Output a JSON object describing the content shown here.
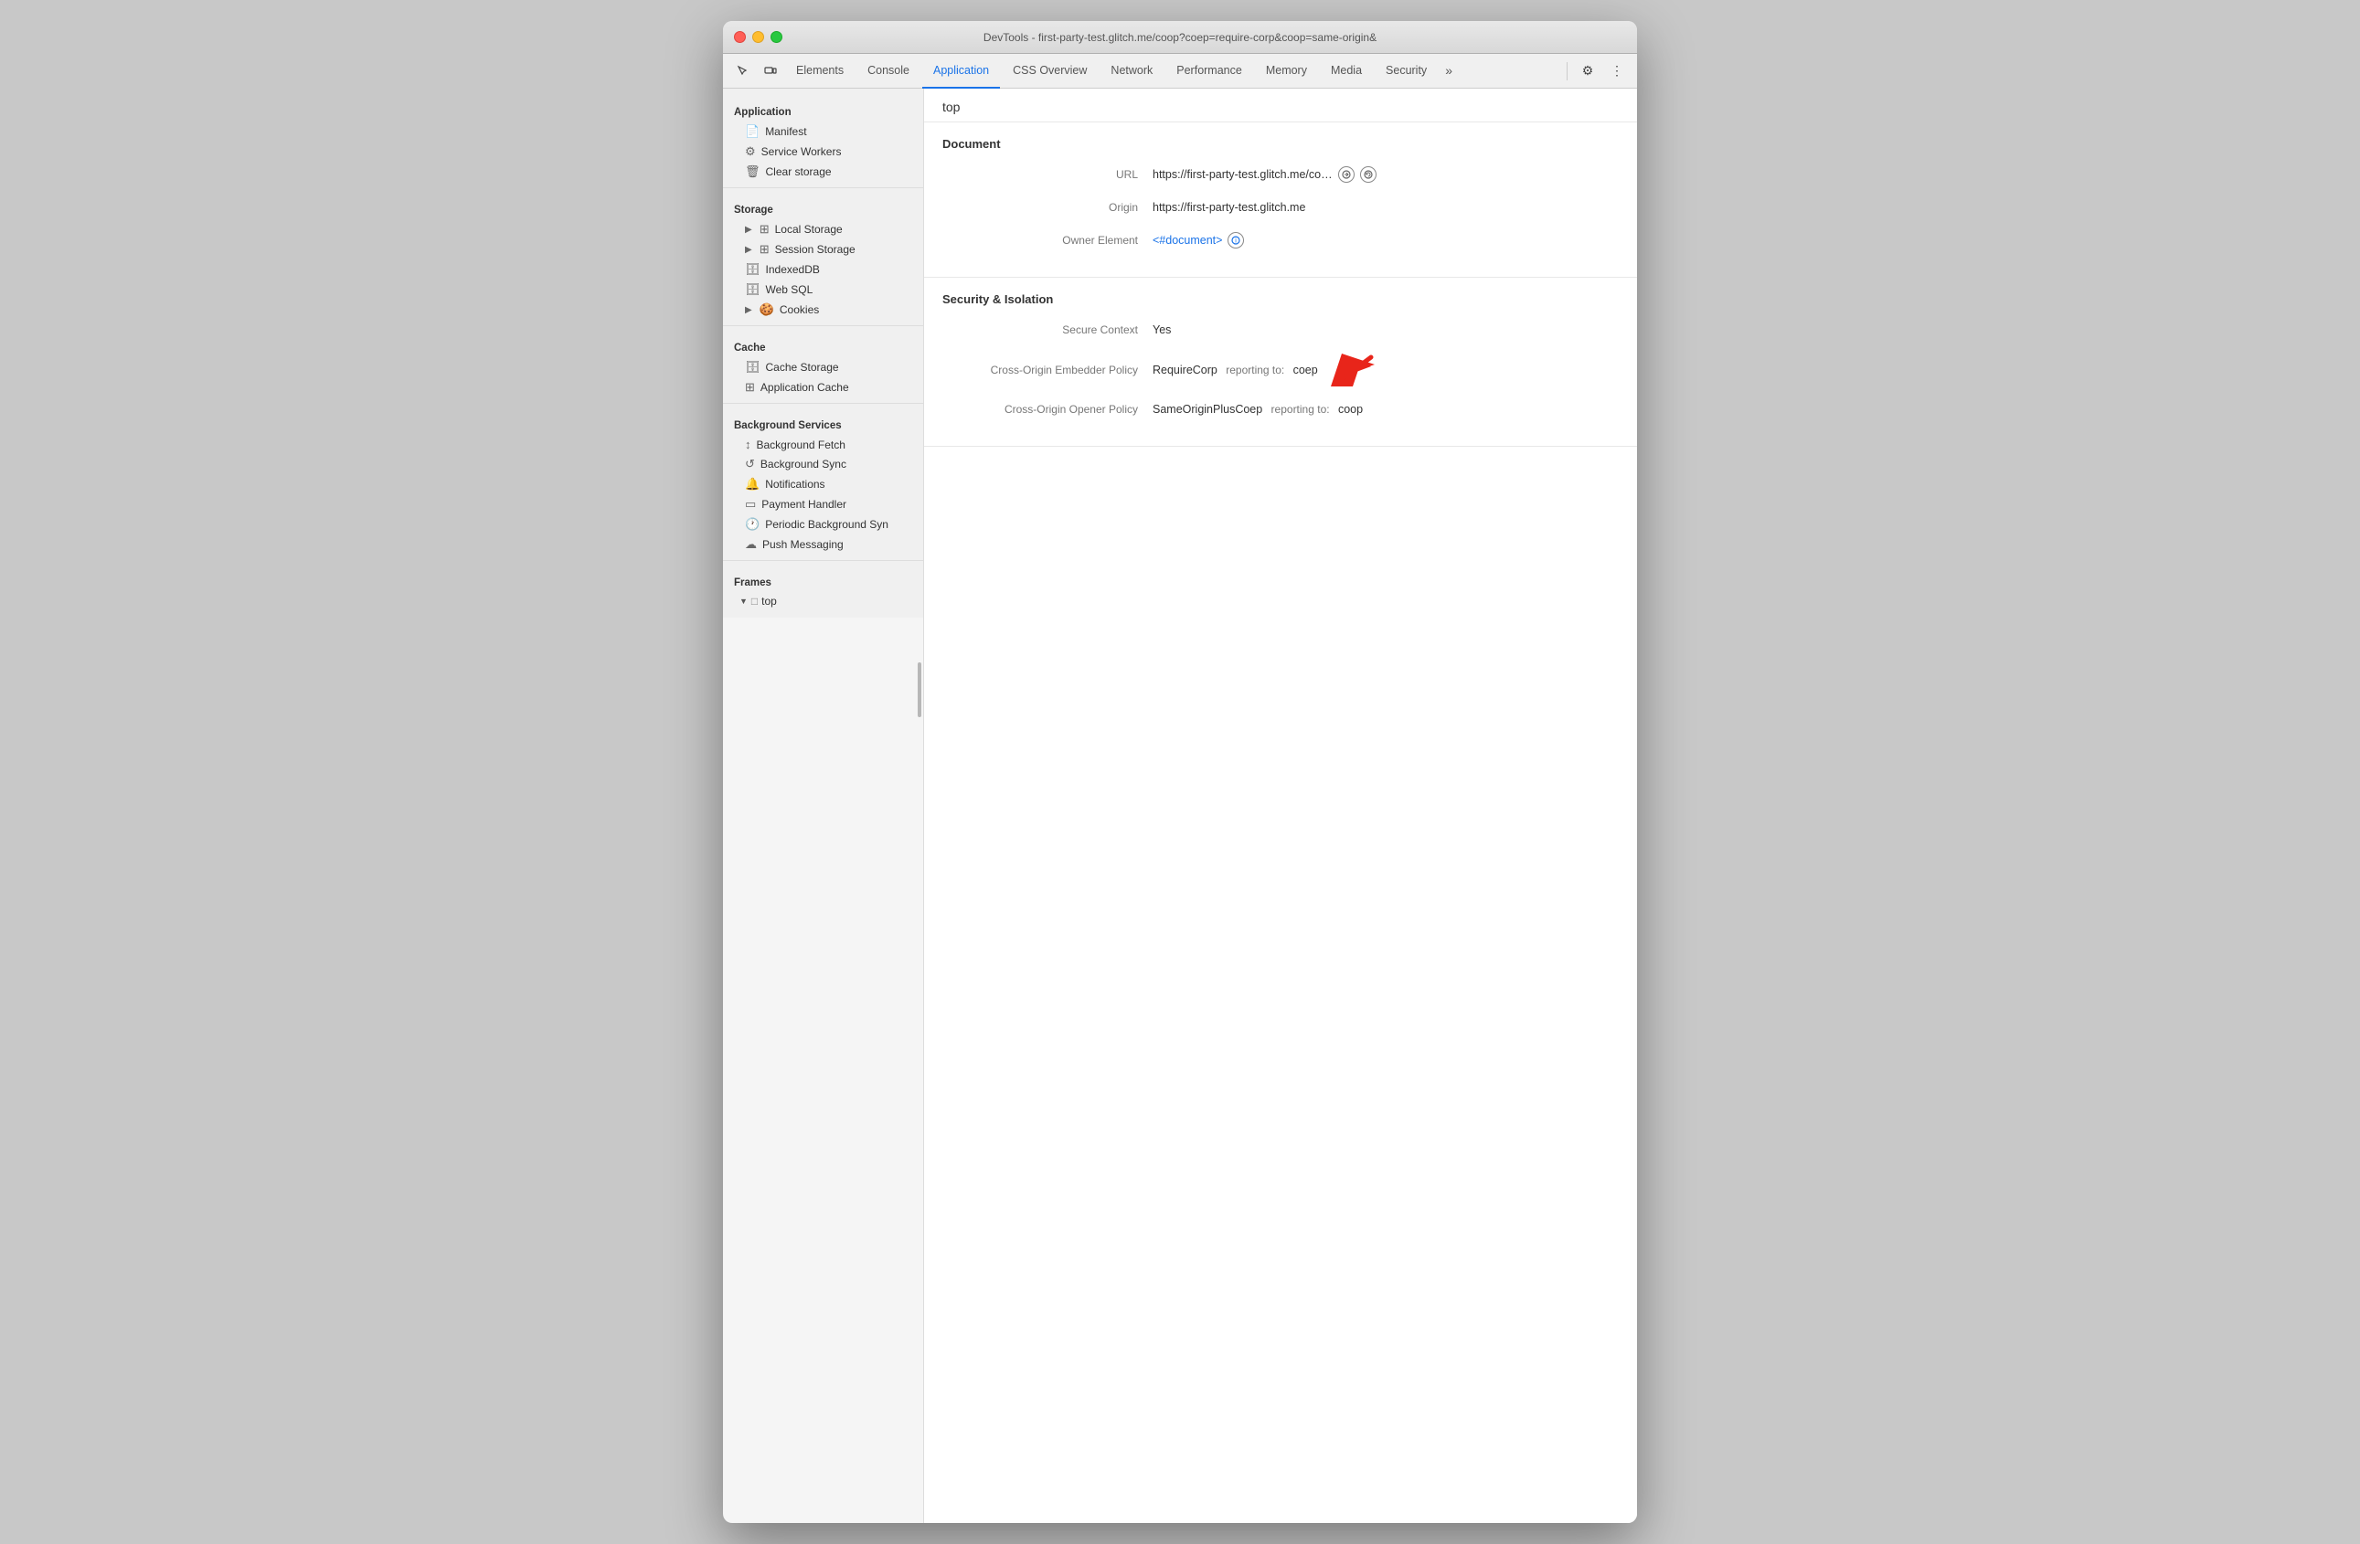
{
  "window": {
    "title": "DevTools - first-party-test.glitch.me/coop?coep=require-corp&coop=same-origin&"
  },
  "toolbar": {
    "tabs": [
      {
        "id": "elements",
        "label": "Elements",
        "active": false
      },
      {
        "id": "console",
        "label": "Console",
        "active": false
      },
      {
        "id": "application",
        "label": "Application",
        "active": true
      },
      {
        "id": "css-overview",
        "label": "CSS Overview",
        "active": false
      },
      {
        "id": "network",
        "label": "Network",
        "active": false
      },
      {
        "id": "performance",
        "label": "Performance",
        "active": false
      },
      {
        "id": "memory",
        "label": "Memory",
        "active": false
      },
      {
        "id": "media",
        "label": "Media",
        "active": false
      },
      {
        "id": "security",
        "label": "Security",
        "active": false
      }
    ],
    "more_tabs_label": "»",
    "settings_icon": "⚙",
    "more_icon": "⋮"
  },
  "sidebar": {
    "sections": [
      {
        "id": "application",
        "title": "Application",
        "items": [
          {
            "id": "manifest",
            "label": "Manifest",
            "icon": "📄",
            "indent": 1
          },
          {
            "id": "service-workers",
            "label": "Service Workers",
            "icon": "⚙",
            "indent": 1
          },
          {
            "id": "clear-storage",
            "label": "Clear storage",
            "icon": "🗑",
            "indent": 1
          }
        ]
      },
      {
        "id": "storage",
        "title": "Storage",
        "items": [
          {
            "id": "local-storage",
            "label": "Local Storage",
            "icon": "▶⊞",
            "indent": 1,
            "expandable": true
          },
          {
            "id": "session-storage",
            "label": "Session Storage",
            "icon": "▶⊞",
            "indent": 1,
            "expandable": true
          },
          {
            "id": "indexeddb",
            "label": "IndexedDB",
            "icon": "🗄",
            "indent": 1
          },
          {
            "id": "web-sql",
            "label": "Web SQL",
            "icon": "🗄",
            "indent": 1
          },
          {
            "id": "cookies",
            "label": "Cookies",
            "icon": "▶🍪",
            "indent": 1,
            "expandable": true
          }
        ]
      },
      {
        "id": "cache",
        "title": "Cache",
        "items": [
          {
            "id": "cache-storage",
            "label": "Cache Storage",
            "icon": "🗄",
            "indent": 1
          },
          {
            "id": "application-cache",
            "label": "Application Cache",
            "icon": "⊞",
            "indent": 1
          }
        ]
      },
      {
        "id": "background-services",
        "title": "Background Services",
        "items": [
          {
            "id": "background-fetch",
            "label": "Background Fetch",
            "icon": "↕",
            "indent": 1
          },
          {
            "id": "background-sync",
            "label": "Background Sync",
            "icon": "↺",
            "indent": 1
          },
          {
            "id": "notifications",
            "label": "Notifications",
            "icon": "🔔",
            "indent": 1
          },
          {
            "id": "payment-handler",
            "label": "Payment Handler",
            "icon": "▭",
            "indent": 1
          },
          {
            "id": "periodic-background-sync",
            "label": "Periodic Background Syn",
            "icon": "🕐",
            "indent": 1
          },
          {
            "id": "push-messaging",
            "label": "Push Messaging",
            "icon": "☁",
            "indent": 1
          }
        ]
      },
      {
        "id": "frames",
        "title": "Frames",
        "items": [
          {
            "id": "top",
            "label": "top",
            "icon": "folder",
            "indent": 0,
            "expanded": true
          }
        ]
      }
    ]
  },
  "content": {
    "page_title": "top",
    "sections": [
      {
        "id": "document",
        "title": "Document",
        "fields": [
          {
            "label": "URL",
            "value": "https://first-party-test.glitch.me/co…",
            "has_link_icon": true,
            "has_reload_icon": true
          },
          {
            "label": "Origin",
            "value": "https://first-party-test.glitch.me",
            "has_link_icon": false
          },
          {
            "label": "Owner Element",
            "value": "<#document>",
            "is_link": true,
            "has_info_icon": true
          }
        ]
      },
      {
        "id": "security",
        "title": "Security & Isolation",
        "fields": [
          {
            "label": "Secure Context",
            "value": "Yes"
          },
          {
            "label": "Cross-Origin Embedder Policy",
            "policy": "RequireCorp",
            "reporting_label": "reporting to:",
            "reporting_value": "coep",
            "has_red_arrow": true
          },
          {
            "label": "Cross-Origin Opener Policy",
            "policy": "SameOriginPlusCoep",
            "reporting_label": "reporting to:",
            "reporting_value": "coop"
          }
        ]
      }
    ]
  }
}
